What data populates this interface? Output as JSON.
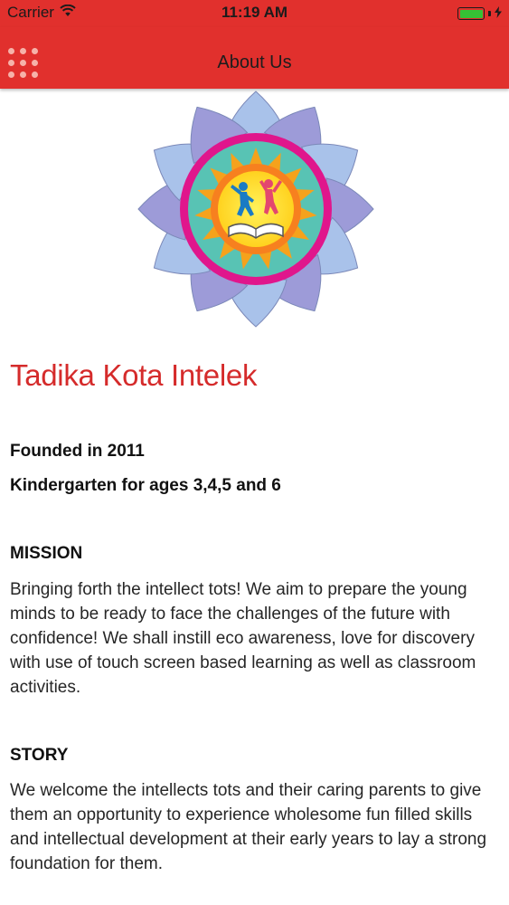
{
  "status_bar": {
    "carrier": "Carrier",
    "time": "11:19 AM",
    "battery_color": "#35c135"
  },
  "nav": {
    "title": "About Us",
    "menu_icon": "grid-dots-icon",
    "background": "#e1302d"
  },
  "about": {
    "school_name": "Tadika Kota Intelek",
    "founded": "Founded in 2011",
    "ages": "Kindergarten for ages 3,4,5 and 6",
    "mission": {
      "heading": "MISSION",
      "text": "Bringing forth the intellect tots! We aim to prepare the young minds to be ready to face the challenges of the future with confidence! We shall instill eco awareness,  love for discovery with use of touch screen based learning as well as classroom activities."
    },
    "story": {
      "heading": "STORY",
      "text": "We welcome the intellects tots and their caring parents to give them an opportunity to experience wholesome fun filled skills and intellectual development at their early years to lay a strong foundation for them."
    }
  },
  "colors": {
    "accent": "#d52b2b",
    "nav_red": "#e1302d"
  }
}
